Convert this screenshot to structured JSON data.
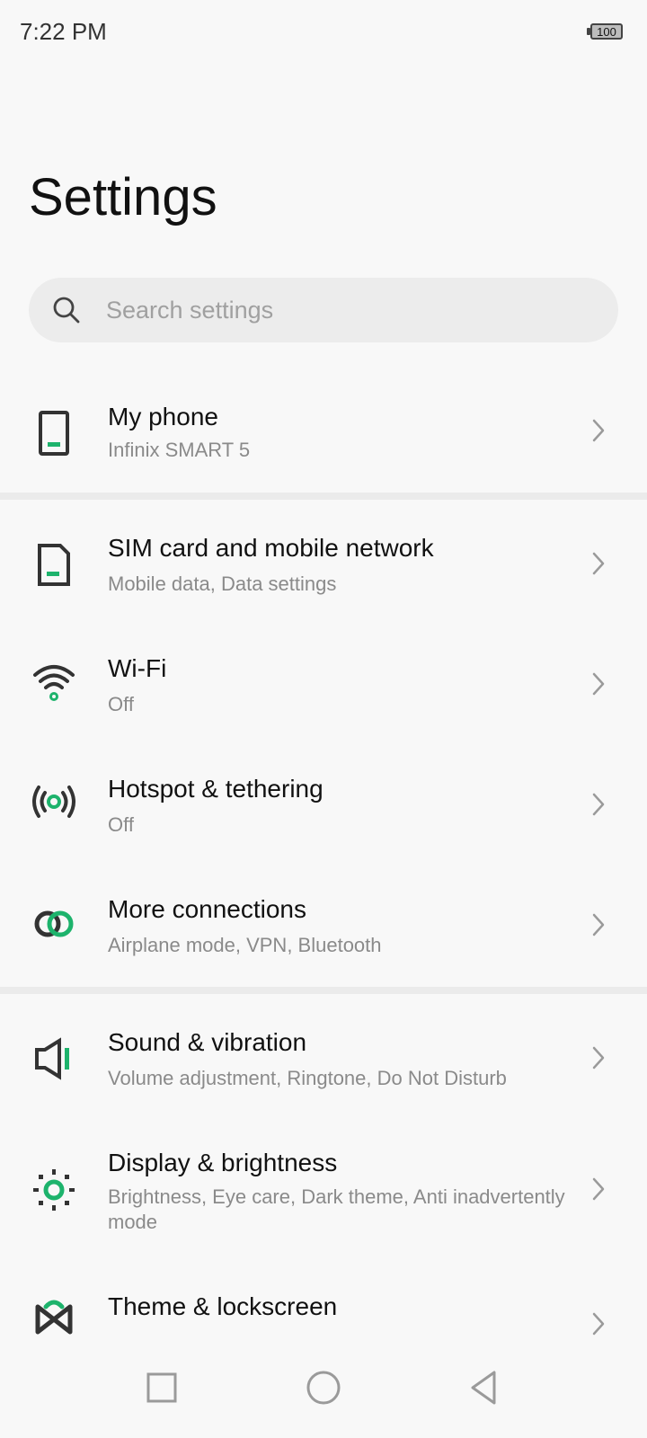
{
  "status_bar": {
    "time": "7:22 PM",
    "battery": "100"
  },
  "page": {
    "title": "Settings"
  },
  "search": {
    "placeholder": "Search settings"
  },
  "colors": {
    "accent": "#1db36c",
    "icon": "#333333",
    "background": "#f8f8f8"
  },
  "items": [
    {
      "title": "My phone",
      "subtitle": "Infinix SMART 5",
      "icon": "phone-icon"
    },
    {
      "title": "SIM card and mobile network",
      "subtitle": "Mobile data, Data settings",
      "icon": "sim-card-icon"
    },
    {
      "title": "Wi-Fi",
      "subtitle": "Off",
      "icon": "wifi-icon"
    },
    {
      "title": "Hotspot & tethering",
      "subtitle": "Off",
      "icon": "hotspot-icon"
    },
    {
      "title": "More connections",
      "subtitle": "Airplane mode, VPN, Bluetooth",
      "icon": "link-icon"
    },
    {
      "title": "Sound & vibration",
      "subtitle": "Volume adjustment, Ringtone, Do Not Disturb",
      "icon": "speaker-icon"
    },
    {
      "title": "Display & brightness",
      "subtitle": "Brightness, Eye care, Dark theme, Anti inadvertently mode",
      "icon": "brightness-icon"
    },
    {
      "title": "Theme & lockscreen",
      "subtitle": "",
      "icon": "theme-icon"
    }
  ],
  "nav": {
    "recents": "recents-icon",
    "home": "home-icon",
    "back": "back-icon"
  }
}
